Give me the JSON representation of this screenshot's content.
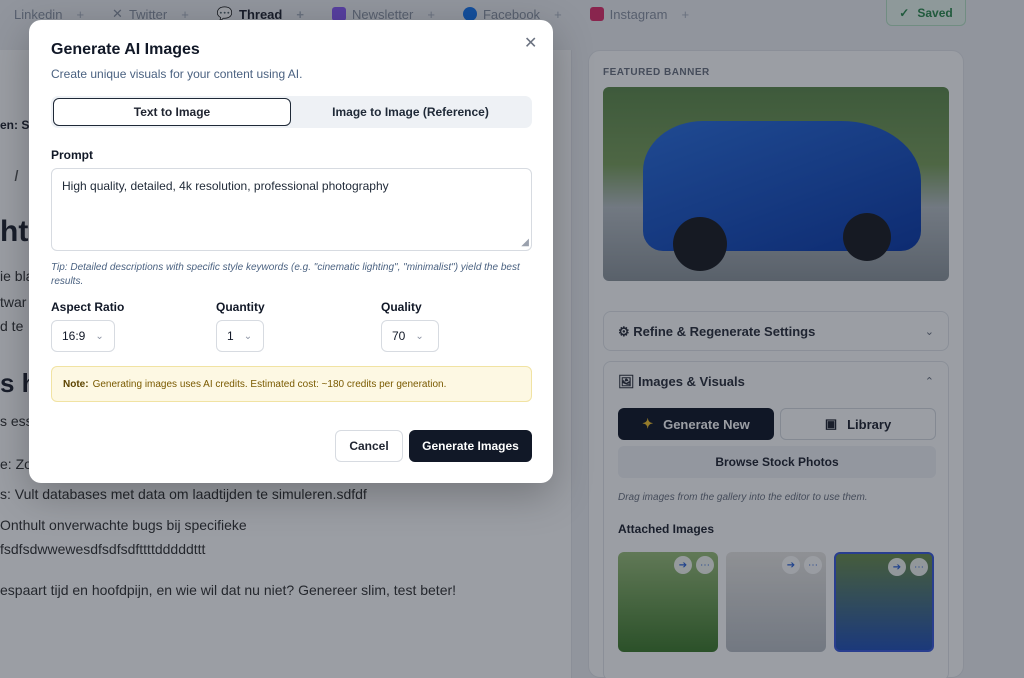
{
  "topbar": {
    "tabs": [
      {
        "label": "Linkedin",
        "icon": "linkedin-icon"
      },
      {
        "label": "Twitter",
        "icon": "twitter-icon"
      },
      {
        "label": "Thread",
        "icon": "thread-icon"
      },
      {
        "label": "Newsletter",
        "icon": "newsletter-icon"
      },
      {
        "label": "Facebook",
        "icon": "facebook-icon"
      },
      {
        "label": "Instagram",
        "icon": "instagram-icon"
      }
    ],
    "plus": "+",
    "saved": "Saved"
  },
  "editor": {
    "crumb": "en: Sli",
    "italic_tool": "I",
    "heading1": "ht",
    "heading2": "s h",
    "lines": [
      "ie bla",
      "twar",
      "d te",
      "s esse",
      "e: Zo",
      "s: Vult databases met data om laadtijden te simuleren.sdfdf",
      "Onthult onverwachte bugs bij specifieke",
      "fsdfsdwwewesdfsdfsdfttttdddddttt",
      "espaart tijd en hoofdpijn, en wie wil dat nu niet? Genereer slim, test beter!"
    ]
  },
  "right_panel": {
    "featured_label": "FEATURED BANNER",
    "refine_title": "Refine & Regenerate Settings",
    "images_title": "Images & Visuals",
    "generate_new": "Generate New",
    "library": "Library",
    "browse_stock": "Browse Stock Photos",
    "drag_hint": "Drag images from the gallery into the editor to use them.",
    "attached_title": "Attached Images"
  },
  "modal": {
    "title": "Generate AI Images",
    "subtitle": "Create unique visuals for your content using AI.",
    "tabs": [
      "Text to Image",
      "Image to Image (Reference)"
    ],
    "prompt_label": "Prompt",
    "prompt_value": "High quality, detailed, 4k resolution, professional photography",
    "tip": "Tip: Detailed descriptions with specific style keywords (e.g. \"cinematic lighting\", \"minimalist\") yield the best results.",
    "aspect_label": "Aspect Ratio",
    "aspect_value": "16:9",
    "quantity_label": "Quantity",
    "quantity_value": "1",
    "quality_label": "Quality",
    "quality_value": "70",
    "note_bold": "Note:",
    "note_text": "Generating images uses AI credits. Estimated cost: ~180 credits per generation.",
    "cancel": "Cancel",
    "generate": "Generate Images"
  },
  "colors": {
    "primary_dark": "#111827",
    "accent_blue": "#2b63d8",
    "saved_green": "#2e8b4f",
    "note_bg": "#fdf8e3"
  }
}
